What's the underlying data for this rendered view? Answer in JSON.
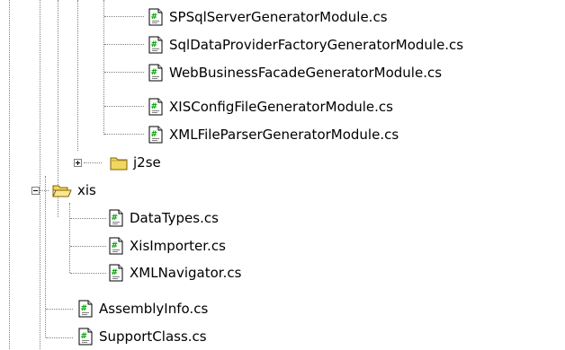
{
  "tree": {
    "items": [
      {
        "label": "SPSqlServerGeneratorModule.cs",
        "icon": "csharp-file-icon"
      },
      {
        "label": "SqlDataProviderFactoryGeneratorModule.cs",
        "icon": "csharp-file-icon"
      },
      {
        "label": "WebBusinessFacadeGeneratorModule.cs",
        "icon": "csharp-file-icon"
      },
      {
        "label": "XISConfigFileGeneratorModule.cs",
        "icon": "csharp-file-icon"
      },
      {
        "label": "XMLFileParserGeneratorModule.cs",
        "icon": "csharp-file-icon"
      },
      {
        "label": "j2se",
        "icon": "folder-closed-icon",
        "expanded": false
      },
      {
        "label": "xis",
        "icon": "folder-open-icon",
        "expanded": true
      },
      {
        "label": "DataTypes.cs",
        "icon": "csharp-file-icon"
      },
      {
        "label": "XisImporter.cs",
        "icon": "csharp-file-icon"
      },
      {
        "label": "XMLNavigator.cs",
        "icon": "csharp-file-icon"
      },
      {
        "label": "AssemblyInfo.cs",
        "icon": "csharp-file-icon"
      },
      {
        "label": "SupportClass.cs",
        "icon": "csharp-file-icon"
      }
    ]
  },
  "colors": {
    "folder_yellow": "#f0d860",
    "connector": "#808080",
    "file_icon_green": "#00a000"
  }
}
